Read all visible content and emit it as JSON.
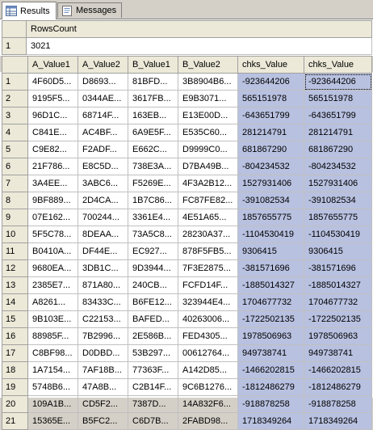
{
  "tabs": [
    {
      "label": "Results",
      "icon": "results-grid-icon",
      "active": true
    },
    {
      "label": "Messages",
      "icon": "messages-icon",
      "active": false
    }
  ],
  "grid1": {
    "columns": [
      "RowsCount"
    ],
    "rows": [
      {
        "n": "1",
        "cells": [
          "3021"
        ]
      }
    ]
  },
  "grid2": {
    "columns": [
      "A_Value1",
      "A_Value2",
      "B_Value1",
      "B_Value2",
      "chks_Value",
      "chks_Value"
    ],
    "rows": [
      {
        "n": "1",
        "cells": [
          "4F60D5...",
          "D8693...",
          "81BFD...",
          "3B8904B6...",
          "-923644206",
          "-923644206"
        ]
      },
      {
        "n": "2",
        "cells": [
          "9195F5...",
          "0344AE...",
          "3617FB...",
          "E9B3071...",
          "565151978",
          "565151978"
        ]
      },
      {
        "n": "3",
        "cells": [
          "96D1C...",
          "68714F...",
          "163EB...",
          "E13E00D...",
          "-643651799",
          "-643651799"
        ]
      },
      {
        "n": "4",
        "cells": [
          "C841E...",
          "AC4BF...",
          "6A9E5F...",
          "E535C60...",
          "281214791",
          "281214791"
        ]
      },
      {
        "n": "5",
        "cells": [
          "C9E82...",
          "F2ADF...",
          "E662C...",
          "D9999C0...",
          "681867290",
          "681867290"
        ]
      },
      {
        "n": "6",
        "cells": [
          "21F786...",
          "E8C5D...",
          "738E3A...",
          "D7BA49B...",
          "-804234532",
          "-804234532"
        ]
      },
      {
        "n": "7",
        "cells": [
          "3A4EE...",
          "3ABC6...",
          "F5269E...",
          "4F3A2B12...",
          "1527931406",
          "1527931406"
        ]
      },
      {
        "n": "8",
        "cells": [
          "9BF889...",
          "2D4CA...",
          "1B7C86...",
          "FC87FE82...",
          "-391082534",
          "-391082534"
        ]
      },
      {
        "n": "9",
        "cells": [
          "07E162...",
          "700244...",
          "3361E4...",
          "4E51A65...",
          "1857655775",
          "1857655775"
        ]
      },
      {
        "n": "10",
        "cells": [
          "5F5C78...",
          "8DEAA...",
          "73A5C8...",
          "28230A37...",
          "-1104530419",
          "-1104530419"
        ]
      },
      {
        "n": "11",
        "cells": [
          "B0410A...",
          "DF44E...",
          "EC927...",
          "878F5FB5...",
          "9306415",
          "9306415"
        ]
      },
      {
        "n": "12",
        "cells": [
          "9680EA...",
          "3DB1C...",
          "9D3944...",
          "7F3E2875...",
          "-381571696",
          "-381571696"
        ]
      },
      {
        "n": "13",
        "cells": [
          "2385E7...",
          "871A80...",
          "240CB...",
          "FCFD14F...",
          "-1885014327",
          "-1885014327"
        ]
      },
      {
        "n": "14",
        "cells": [
          "A8261...",
          "83433C...",
          "B6FE12...",
          "323944E4...",
          "1704677732",
          "1704677732"
        ]
      },
      {
        "n": "15",
        "cells": [
          "9B103E...",
          "C22153...",
          "BAFED...",
          "40263006...",
          "-1722502135",
          "-1722502135"
        ]
      },
      {
        "n": "16",
        "cells": [
          "88985F...",
          "7B2996...",
          "2E586B...",
          "FED4305...",
          "1978506963",
          "1978506963"
        ]
      },
      {
        "n": "17",
        "cells": [
          "C8BF98...",
          "D0DBD...",
          "53B297...",
          "00612764...",
          "949738741",
          "949738741"
        ]
      },
      {
        "n": "18",
        "cells": [
          "1A7154...",
          "7AF18B...",
          "77363F...",
          "A142D85...",
          "-1466202815",
          "-1466202815"
        ]
      },
      {
        "n": "19",
        "cells": [
          "5748B6...",
          "47A8B...",
          "C2B14F...",
          "9C6B1276...",
          "-1812486279",
          "-1812486279"
        ]
      },
      {
        "n": "20",
        "cells": [
          "109A1B...",
          "CD5F2...",
          "7387D...",
          "14A832F6...",
          "-918878258",
          "-918878258"
        ]
      },
      {
        "n": "21",
        "cells": [
          "15365E...",
          "B5FC2...",
          "C6D7B...",
          "2FABD98...",
          "1718349264",
          "1718349264"
        ]
      }
    ]
  }
}
